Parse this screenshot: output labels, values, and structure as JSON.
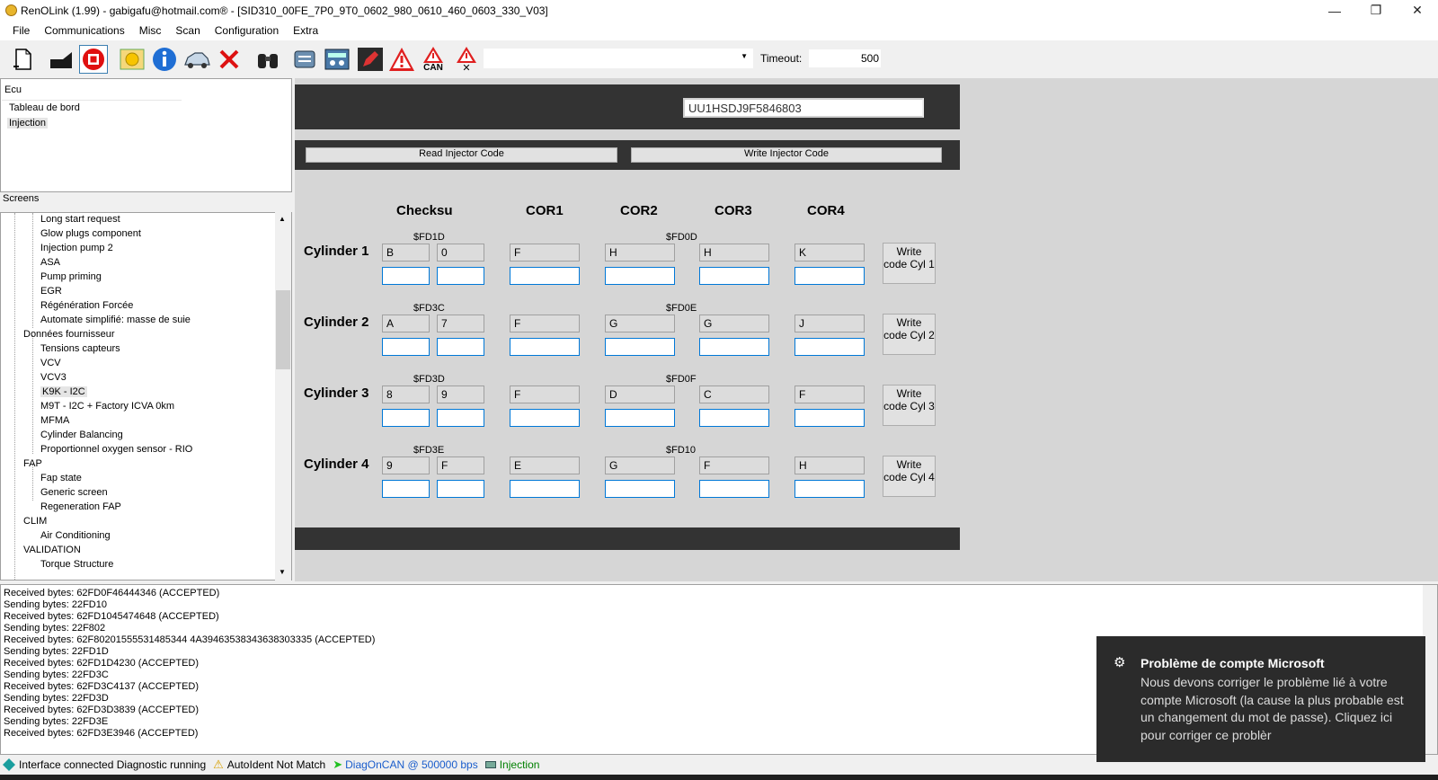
{
  "window": {
    "title": "RenOLink (1.99) - gabigafu@hotmail.com® - [SID310_00FE_7P0_9T0_0602_980_0610_460_0603_330_V03]"
  },
  "menu": [
    "File",
    "Communications",
    "Misc",
    "Scan",
    "Configuration",
    "Extra"
  ],
  "toolbar": {
    "can_label": "CAN",
    "timeout_label": "Timeout:",
    "timeout_value": "500",
    "combo_value": ""
  },
  "ecu_panel": {
    "header": "Ecu",
    "items": [
      "Tableau de bord",
      "Injection"
    ]
  },
  "screens": {
    "label": "Screens",
    "items": [
      {
        "label": "Long start request",
        "level": 2
      },
      {
        "label": "Glow plugs component",
        "level": 2
      },
      {
        "label": "Injection pump 2",
        "level": 2
      },
      {
        "label": "ASA",
        "level": 2
      },
      {
        "label": "Pump priming",
        "level": 2
      },
      {
        "label": "EGR",
        "level": 2
      },
      {
        "label": "Régénération Forcée",
        "level": 2
      },
      {
        "label": "Automate simplifié: masse de suie",
        "level": 2
      },
      {
        "label": "Données fournisseur",
        "level": 1
      },
      {
        "label": "Tensions capteurs",
        "level": 2
      },
      {
        "label": "VCV",
        "level": 2
      },
      {
        "label": "VCV3",
        "level": 2
      },
      {
        "label": "K9K - I2C",
        "level": 2
      },
      {
        "label": "M9T - I2C + Factory ICVA 0km",
        "level": 2
      },
      {
        "label": "MFMA",
        "level": 2
      },
      {
        "label": "Cylinder Balancing",
        "level": 2
      },
      {
        "label": "Proportionnel oxygen sensor - RIO",
        "level": 2
      },
      {
        "label": "FAP",
        "level": 1
      },
      {
        "label": "Fap state",
        "level": 2
      },
      {
        "label": "Generic screen",
        "level": 2
      },
      {
        "label": "Regeneration FAP",
        "level": 2
      },
      {
        "label": "CLIM",
        "level": 1
      },
      {
        "label": "Air Conditioning",
        "level": 2
      },
      {
        "label": "VALIDATION",
        "level": 1
      },
      {
        "label": "Torque Structure",
        "level": 2
      }
    ]
  },
  "main": {
    "vin": "UU1HSDJ9F5846803",
    "read_btn": "Read Injector Code",
    "write_btn": "Write Injector Code",
    "col_headers": [
      "Checksu",
      "COR1",
      "COR2",
      "COR3",
      "COR4"
    ],
    "cylinders": [
      {
        "label": "Cylinder 1",
        "hex1": "$FD1D",
        "hex2": "$FD0D",
        "values": [
          "B",
          "0",
          "F",
          "H",
          "H",
          "K"
        ],
        "btn": "Write code Cyl 1"
      },
      {
        "label": "Cylinder 2",
        "hex1": "$FD3C",
        "hex2": "$FD0E",
        "values": [
          "A",
          "7",
          "F",
          "G",
          "G",
          "J"
        ],
        "btn": "Write code Cyl 2"
      },
      {
        "label": "Cylinder 3",
        "hex1": "$FD3D",
        "hex2": "$FD0F",
        "values": [
          "8",
          "9",
          "F",
          "D",
          "C",
          "F"
        ],
        "btn": "Write code Cyl 3"
      },
      {
        "label": "Cylinder 4",
        "hex1": "$FD3E",
        "hex2": "$FD10",
        "values": [
          "9",
          "F",
          "E",
          "G",
          "F",
          "H"
        ],
        "btn": "Write code Cyl 4"
      }
    ]
  },
  "log": [
    "Received bytes: 62FD0F46444346 (ACCEPTED)",
    "Sending bytes: 22FD10",
    "Received bytes: 62FD1045474648 (ACCEPTED)",
    "Sending bytes: 22F802",
    "Received bytes: 62F80201555531485344 4A39463538343638303335 (ACCEPTED)",
    "Sending bytes: 22FD1D",
    "Received bytes: 62FD1D4230 (ACCEPTED)",
    "Sending bytes: 22FD3C",
    "Received bytes: 62FD3C4137 (ACCEPTED)",
    "Sending bytes: 22FD3D",
    "Received bytes: 62FD3D3839 (ACCEPTED)",
    "Sending bytes: 22FD3E",
    "Received bytes: 62FD3E3946 (ACCEPTED)"
  ],
  "status": {
    "connected": "Interface connected Diagnostic running",
    "autoident": "AutoIdent Not Match",
    "diag": "DiagOnCAN @ 500000 bps",
    "ecu": "Injection"
  },
  "toast": {
    "title": "Problème de compte Microsoft",
    "body": "Nous devons corriger le problème lié à votre compte Microsoft (la cause la plus probable est un changement du mot de passe). Cliquez ici pour corriger ce problèr"
  },
  "colors": {
    "dark_band": "#333333",
    "input_border": "#0078d7",
    "status_green": "#008000",
    "toast_bg": "#2b2b2b"
  }
}
